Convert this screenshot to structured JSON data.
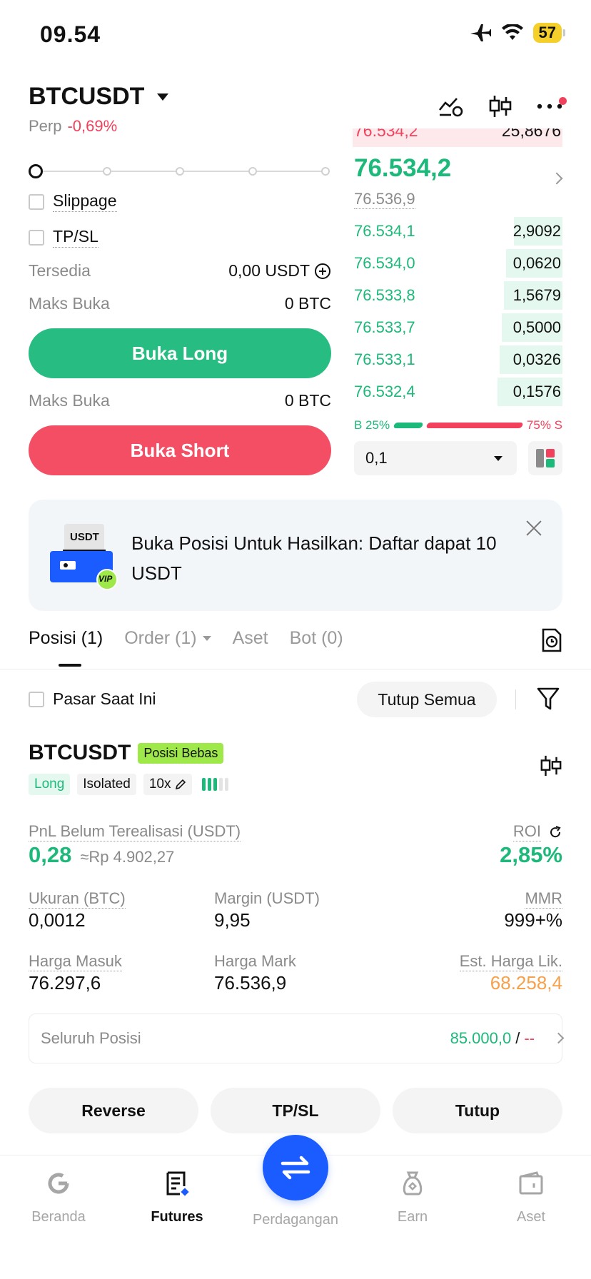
{
  "status_bar": {
    "time": "09.54",
    "battery": "57"
  },
  "header": {
    "pair": "BTCUSDT",
    "type": "Perp",
    "change": "-0,69%"
  },
  "form": {
    "slippage_label": "Slippage",
    "tpsl_label": "TP/SL",
    "available_label": "Tersedia",
    "available_value": "0,00 USDT",
    "max_open_long_label": "Maks Buka",
    "max_open_long_value": "0 BTC",
    "open_long_label": "Buka Long",
    "max_open_short_label": "Maks Buka",
    "max_open_short_value": "0 BTC",
    "open_short_label": "Buka Short"
  },
  "orderbook": {
    "top_cut_price": "76.534,2",
    "top_cut_qty": "25,8676",
    "last_price": "76.534,2",
    "mark_price": "76.536,9",
    "bids": [
      {
        "price": "76.534,1",
        "qty": "2,9092",
        "depth": 0.23
      },
      {
        "price": "76.534,0",
        "qty": "0,0620",
        "depth": 0.27
      },
      {
        "price": "76.533,8",
        "qty": "1,5679",
        "depth": 0.28
      },
      {
        "price": "76.533,7",
        "qty": "0,5000",
        "depth": 0.29
      },
      {
        "price": "76.533,1",
        "qty": "0,0326",
        "depth": 0.3
      },
      {
        "price": "76.532,4",
        "qty": "0,1576",
        "depth": 0.31
      }
    ],
    "buy_ratio": "B 25%",
    "sell_ratio": "75% S",
    "buy_fraction": 0.25,
    "depth_step": "0,1"
  },
  "banner": {
    "icon_label": "USDT",
    "vip_label": "VIP",
    "text": "Buka Posisi Untuk Hasilkan: Daftar dapat 10 USDT"
  },
  "tabs": {
    "positions": "Posisi (1)",
    "orders": "Order (1)",
    "assets": "Aset",
    "bots": "Bot (0)"
  },
  "filter": {
    "current_market_label": "Pasar Saat Ini",
    "close_all_label": "Tutup Semua"
  },
  "position": {
    "pair": "BTCUSDT",
    "badge": "Posisi Bebas",
    "side": "Long",
    "margin_mode": "Isolated",
    "leverage": "10x",
    "pnl_label": "PnL Belum Terealisasi (USDT)",
    "pnl_value": "0,28",
    "pnl_idr": "≈Rp 4.902,27",
    "roi_label": "ROI",
    "roi_value": "2,85%",
    "size_label": "Ukuran (BTC)",
    "size_value": "0,0012",
    "margin_label": "Margin (USDT)",
    "margin_value": "9,95",
    "mmr_label": "MMR",
    "mmr_value": "999+%",
    "entry_label": "Harga Masuk",
    "entry_value": "76.297,6",
    "mark_label": "Harga Mark",
    "mark_value": "76.536,9",
    "liq_label": "Est. Harga Lik.",
    "liq_value": "68.258,4",
    "total_label": "Seluruh Posisi",
    "total_value": "85.000,0",
    "total_sep": "/",
    "total_dash": "--"
  },
  "actions": {
    "reverse": "Reverse",
    "tpsl": "TP/SL",
    "close": "Tutup"
  },
  "bottom_nav": {
    "home": "Beranda",
    "futures": "Futures",
    "trade": "Perdagangan",
    "earn": "Earn",
    "assets": "Aset"
  },
  "colors": {
    "green": "#1db97a",
    "red": "#f1415c",
    "orange": "#f7a04b",
    "fab_blue": "#1a5cff",
    "badge_lime": "#9ee84a"
  }
}
